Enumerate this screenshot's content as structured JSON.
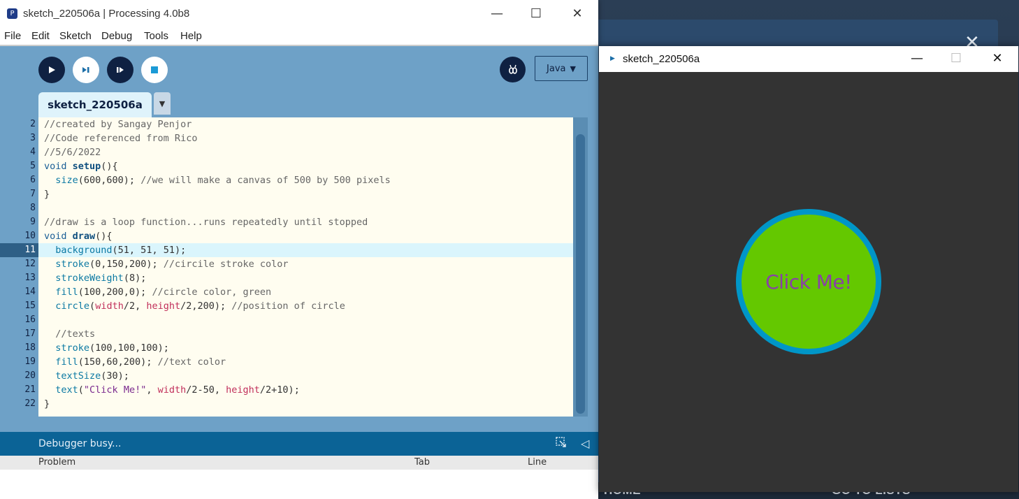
{
  "background": {
    "partial_text_left": "HOME",
    "partial_text_right": "GO TO LISTS",
    "close_glyph": "✕"
  },
  "ide": {
    "title": "sketch_220506a | Processing 4.0b8",
    "menu": [
      "File",
      "Edit",
      "Sketch",
      "Debug",
      "Tools",
      "Help"
    ],
    "mode": "Java",
    "tab_name": "sketch_220506a",
    "line_numbers": [
      "2",
      "3",
      "4",
      "5",
      "6",
      "7",
      "8",
      "9",
      "10",
      "11",
      "12",
      "13",
      "14",
      "15",
      "16",
      "17",
      "18",
      "19",
      "20",
      "21",
      "22"
    ],
    "highlighted_line": "11",
    "code_lines": [
      [
        {
          "t": "//created by Sangay Penjor",
          "c": "com"
        }
      ],
      [
        {
          "t": "//Code referenced from Rico",
          "c": "com"
        }
      ],
      [
        {
          "t": "//5/6/2022",
          "c": "com"
        }
      ],
      [
        {
          "t": "void ",
          "c": "kw"
        },
        {
          "t": "setup",
          "c": "fn"
        },
        {
          "t": "(){",
          "c": ""
        }
      ],
      [
        {
          "t": "  ",
          "c": ""
        },
        {
          "t": "size",
          "c": "call"
        },
        {
          "t": "(600,600); ",
          "c": ""
        },
        {
          "t": "//we will make a canvas of 500 by 500 pixels",
          "c": "com"
        }
      ],
      [
        {
          "t": "}",
          "c": ""
        }
      ],
      [],
      [
        {
          "t": "//draw is a loop function...runs repeatedly until stopped",
          "c": "com"
        }
      ],
      [
        {
          "t": "void ",
          "c": "kw"
        },
        {
          "t": "draw",
          "c": "fn"
        },
        {
          "t": "(){",
          "c": ""
        }
      ],
      [
        {
          "t": "  ",
          "c": ""
        },
        {
          "t": "background",
          "c": "call"
        },
        {
          "t": "(51, 51, 51);",
          "c": ""
        }
      ],
      [
        {
          "t": "  ",
          "c": ""
        },
        {
          "t": "stroke",
          "c": "call"
        },
        {
          "t": "(0,150,200); ",
          "c": ""
        },
        {
          "t": "//circile stroke color",
          "c": "com"
        }
      ],
      [
        {
          "t": "  ",
          "c": ""
        },
        {
          "t": "strokeWeight",
          "c": "call"
        },
        {
          "t": "(8);",
          "c": ""
        }
      ],
      [
        {
          "t": "  ",
          "c": ""
        },
        {
          "t": "fill",
          "c": "call"
        },
        {
          "t": "(100,200,0); ",
          "c": ""
        },
        {
          "t": "//circle color, green",
          "c": "com"
        }
      ],
      [
        {
          "t": "  ",
          "c": ""
        },
        {
          "t": "circle",
          "c": "call"
        },
        {
          "t": "(",
          "c": ""
        },
        {
          "t": "width",
          "c": "var"
        },
        {
          "t": "/2, ",
          "c": ""
        },
        {
          "t": "height",
          "c": "var"
        },
        {
          "t": "/2,200); ",
          "c": ""
        },
        {
          "t": "//position of circle",
          "c": "com"
        }
      ],
      [],
      [
        {
          "t": "  ",
          "c": ""
        },
        {
          "t": "//texts",
          "c": "com"
        }
      ],
      [
        {
          "t": "  ",
          "c": ""
        },
        {
          "t": "stroke",
          "c": "call"
        },
        {
          "t": "(100,100,100);",
          "c": ""
        }
      ],
      [
        {
          "t": "  ",
          "c": ""
        },
        {
          "t": "fill",
          "c": "call"
        },
        {
          "t": "(150,60,200); ",
          "c": ""
        },
        {
          "t": "//text color",
          "c": "com"
        }
      ],
      [
        {
          "t": "  ",
          "c": ""
        },
        {
          "t": "textSize",
          "c": "call"
        },
        {
          "t": "(30);",
          "c": ""
        }
      ],
      [
        {
          "t": "  ",
          "c": ""
        },
        {
          "t": "text",
          "c": "call"
        },
        {
          "t": "(",
          "c": ""
        },
        {
          "t": "\"Click Me!\"",
          "c": "str"
        },
        {
          "t": ", ",
          "c": ""
        },
        {
          "t": "width",
          "c": "var"
        },
        {
          "t": "/2-50, ",
          "c": ""
        },
        {
          "t": "height",
          "c": "var"
        },
        {
          "t": "/2+10);",
          "c": ""
        }
      ],
      [
        {
          "t": "}",
          "c": ""
        }
      ]
    ],
    "status": "Debugger busy...",
    "problems_columns": [
      "Problem",
      "Tab",
      "Line"
    ]
  },
  "sketch_window": {
    "title": "sketch_220506a",
    "button_text": "Click Me!",
    "colors": {
      "canvas": "#333333",
      "circle_fill": "#64c800",
      "circle_stroke": "#0096c8",
      "text": "#8a3fa8"
    }
  }
}
